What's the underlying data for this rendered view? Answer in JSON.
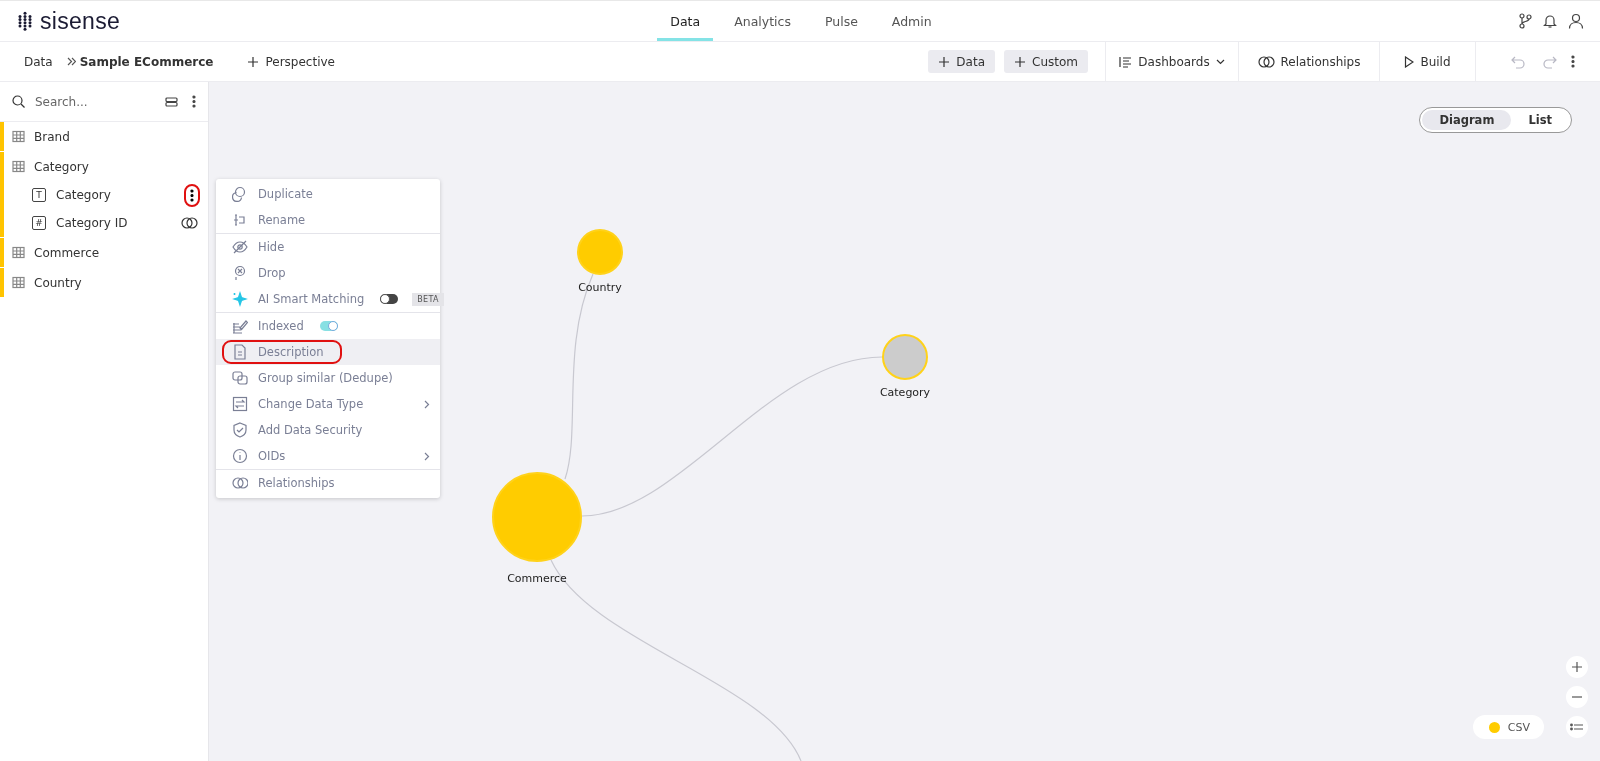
{
  "header": {
    "logo": "sisense",
    "tabs": [
      {
        "label": "Data",
        "selected": true
      },
      {
        "label": "Analytics",
        "selected": false
      },
      {
        "label": "Pulse",
        "selected": false
      },
      {
        "label": "Admin",
        "selected": false
      }
    ]
  },
  "toolbar": {
    "breadcrumb": [
      {
        "label": "Data",
        "current": false
      },
      {
        "label": "Sample ECommerce",
        "current": true
      }
    ],
    "perspective": "Perspective",
    "add_buttons": [
      "Data",
      "Custom"
    ],
    "dashboards": "Dashboards",
    "relationships": "Relationships",
    "build": "Build",
    "history": [
      {
        "kind": "undo",
        "disabled": true
      },
      {
        "kind": "redo",
        "disabled": true
      }
    ]
  },
  "sidebar": {
    "search": {
      "placeholder": "Search..."
    },
    "tables": [
      {
        "name": "Brand"
      },
      {
        "name": "Category",
        "fields": [
          {
            "type": "T",
            "name": "Category",
            "related": false,
            "highlighted": true
          },
          {
            "type": "#",
            "name": "Category ID",
            "related": true,
            "highlighted": false
          }
        ]
      },
      {
        "name": "Commerce"
      },
      {
        "name": "Country"
      }
    ]
  },
  "context_menu": {
    "groups": [
      [
        {
          "label": "Duplicate",
          "kind": "action",
          "submenu": false,
          "highlighted": false
        },
        {
          "label": "Rename",
          "kind": "action",
          "submenu": false,
          "highlighted": false
        }
      ],
      [
        {
          "label": "Hide",
          "kind": "action",
          "submenu": false,
          "highlighted": false
        },
        {
          "label": "Drop",
          "kind": "action",
          "submenu": false,
          "highlighted": false
        },
        {
          "label": "AI Smart Matching",
          "kind": "toggle",
          "on": false,
          "badge": "BETA",
          "submenu": false,
          "highlighted": false
        }
      ],
      [
        {
          "label": "Indexed",
          "kind": "toggle",
          "on": true,
          "submenu": false,
          "highlighted": false
        },
        {
          "label": "Description",
          "kind": "action",
          "submenu": false,
          "highlighted": true
        },
        {
          "label": "Group similar (Dedupe)",
          "kind": "action",
          "submenu": false,
          "highlighted": false
        },
        {
          "label": "Change Data Type",
          "kind": "action",
          "submenu": true,
          "highlighted": false
        },
        {
          "label": "Add Data Security",
          "kind": "action",
          "submenu": false,
          "highlighted": false
        },
        {
          "label": "OIDs",
          "kind": "action",
          "submenu": true,
          "highlighted": false
        }
      ],
      [
        {
          "label": "Relationships",
          "kind": "action",
          "submenu": false,
          "highlighted": false
        }
      ]
    ]
  },
  "view_switch": [
    {
      "label": "Diagram",
      "selected": true
    },
    {
      "label": "List",
      "selected": false
    }
  ],
  "diagram": {
    "nodes": [
      {
        "label": "Country",
        "color": "#ffcc00"
      },
      {
        "label": "Category",
        "color": "#cccccc"
      },
      {
        "label": "Commerce",
        "color": "#ffcc00"
      }
    ]
  },
  "legend": [
    {
      "label": "CSV",
      "color": "#ffcc00"
    }
  ]
}
